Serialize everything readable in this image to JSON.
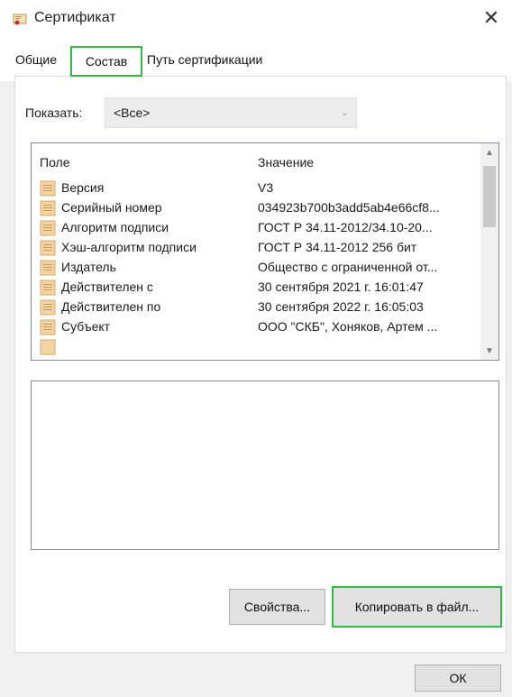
{
  "window": {
    "title": "Сертификат",
    "close_glyph": "✕",
    "icon": "certificate-icon"
  },
  "tabs": [
    {
      "label": "Общие"
    },
    {
      "label": "Состав"
    },
    {
      "label": "Путь сертификации"
    }
  ],
  "active_tab": "Состав",
  "show": {
    "label": "Показать:",
    "value": "<Все>"
  },
  "list": {
    "columns": {
      "field": "Поле",
      "value": "Значение"
    },
    "rows": [
      {
        "field": "Версия",
        "value": "V3"
      },
      {
        "field": "Серийный номер",
        "value": "034923b700b3add5ab4e66cf8..."
      },
      {
        "field": "Алгоритм подписи",
        "value": "ГОСТ Р 34.11-2012/34.10-20..."
      },
      {
        "field": "Хэш-алгоритм подписи",
        "value": "ГОСТ Р 34.11-2012 256 бит"
      },
      {
        "field": "Издатель",
        "value": "Общество с ограниченной от..."
      },
      {
        "field": "Действителен с",
        "value": "30 сентября 2021 г. 16:01:47"
      },
      {
        "field": "Действителен по",
        "value": "30 сентября 2022 г. 16:05:03"
      },
      {
        "field": "Субъект",
        "value": "ООО \"СКБ\", Хоняков, Артем ..."
      }
    ]
  },
  "buttons": {
    "properties": "Свойства...",
    "copy_to_file": "Копировать в файл...",
    "ok": "ОК"
  },
  "colors": {
    "highlight": "#2fbb3f",
    "row_icon": "#f0c890"
  }
}
